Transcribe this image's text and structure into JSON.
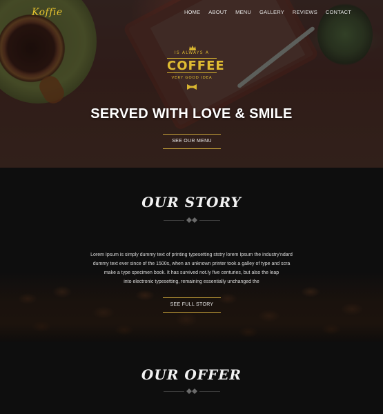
{
  "brand": {
    "logo": "Koffie"
  },
  "nav": {
    "items": [
      {
        "label": "HOME"
      },
      {
        "label": "ABOUT"
      },
      {
        "label": "MENU"
      },
      {
        "label": "GALLERY"
      },
      {
        "label": "REVIEWS"
      },
      {
        "label": "CONTACT"
      }
    ]
  },
  "hero": {
    "badge": {
      "top": "IS ALWAYS A",
      "main": "COFFEE",
      "sub": "VERY GOOD IDEA"
    },
    "title": "SERVED WITH LOVE & SMILE",
    "button": "SEE OUR MENU"
  },
  "story": {
    "title": "OUR STORY",
    "lines": [
      "Lorem Ipsum is simply dummy text of printing typesetting ststry  lorem Ipsum  the industry'ndard",
      "dummy text ever since of the 1500s, when an unknown printer took a galley of type and scra",
      "make a type specimen book. It has survived not.ly five centuries, but also the leap",
      "into electronic typesetting, remaining essentially unchanged the"
    ],
    "button": "SEE FULL STORY"
  },
  "offer": {
    "title": "OUR OFFER"
  },
  "colors": {
    "accent": "#c9a43a",
    "logo": "#e6c22e",
    "background": "#0e0e0e"
  }
}
